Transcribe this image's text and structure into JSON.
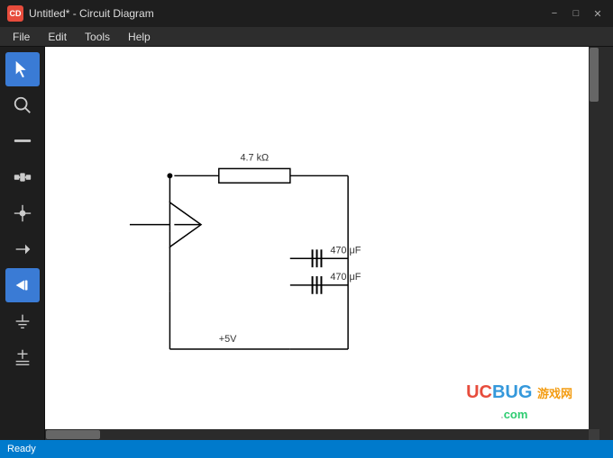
{
  "titlebar": {
    "app_icon": "CD",
    "title": "Untitled* - Circuit Diagram",
    "minimize": "−",
    "maximize": "□",
    "close": "✕"
  },
  "menu": {
    "items": [
      "File",
      "Edit",
      "Tools",
      "Help"
    ]
  },
  "toolbar": {
    "tools": [
      {
        "name": "select",
        "icon": "cursor"
      },
      {
        "name": "zoom",
        "icon": "magnifier"
      },
      {
        "name": "wire",
        "icon": "wire"
      },
      {
        "name": "component",
        "icon": "component"
      },
      {
        "name": "junction",
        "icon": "junction"
      },
      {
        "name": "pin",
        "icon": "pin"
      },
      {
        "name": "fill",
        "icon": "fill"
      },
      {
        "name": "ground",
        "icon": "ground"
      },
      {
        "name": "more",
        "icon": "more"
      }
    ]
  },
  "circuit": {
    "resistor_label": "4.7 kΩ",
    "cap1_label": "470 μF",
    "cap2_label": "470 μF",
    "voltage_label": "+5V"
  },
  "status": {
    "text": "Ready"
  },
  "watermark": {
    "uc": "UC",
    "bug": "BUG",
    "games": "游戏网",
    "dot": ".",
    "com": "com"
  }
}
